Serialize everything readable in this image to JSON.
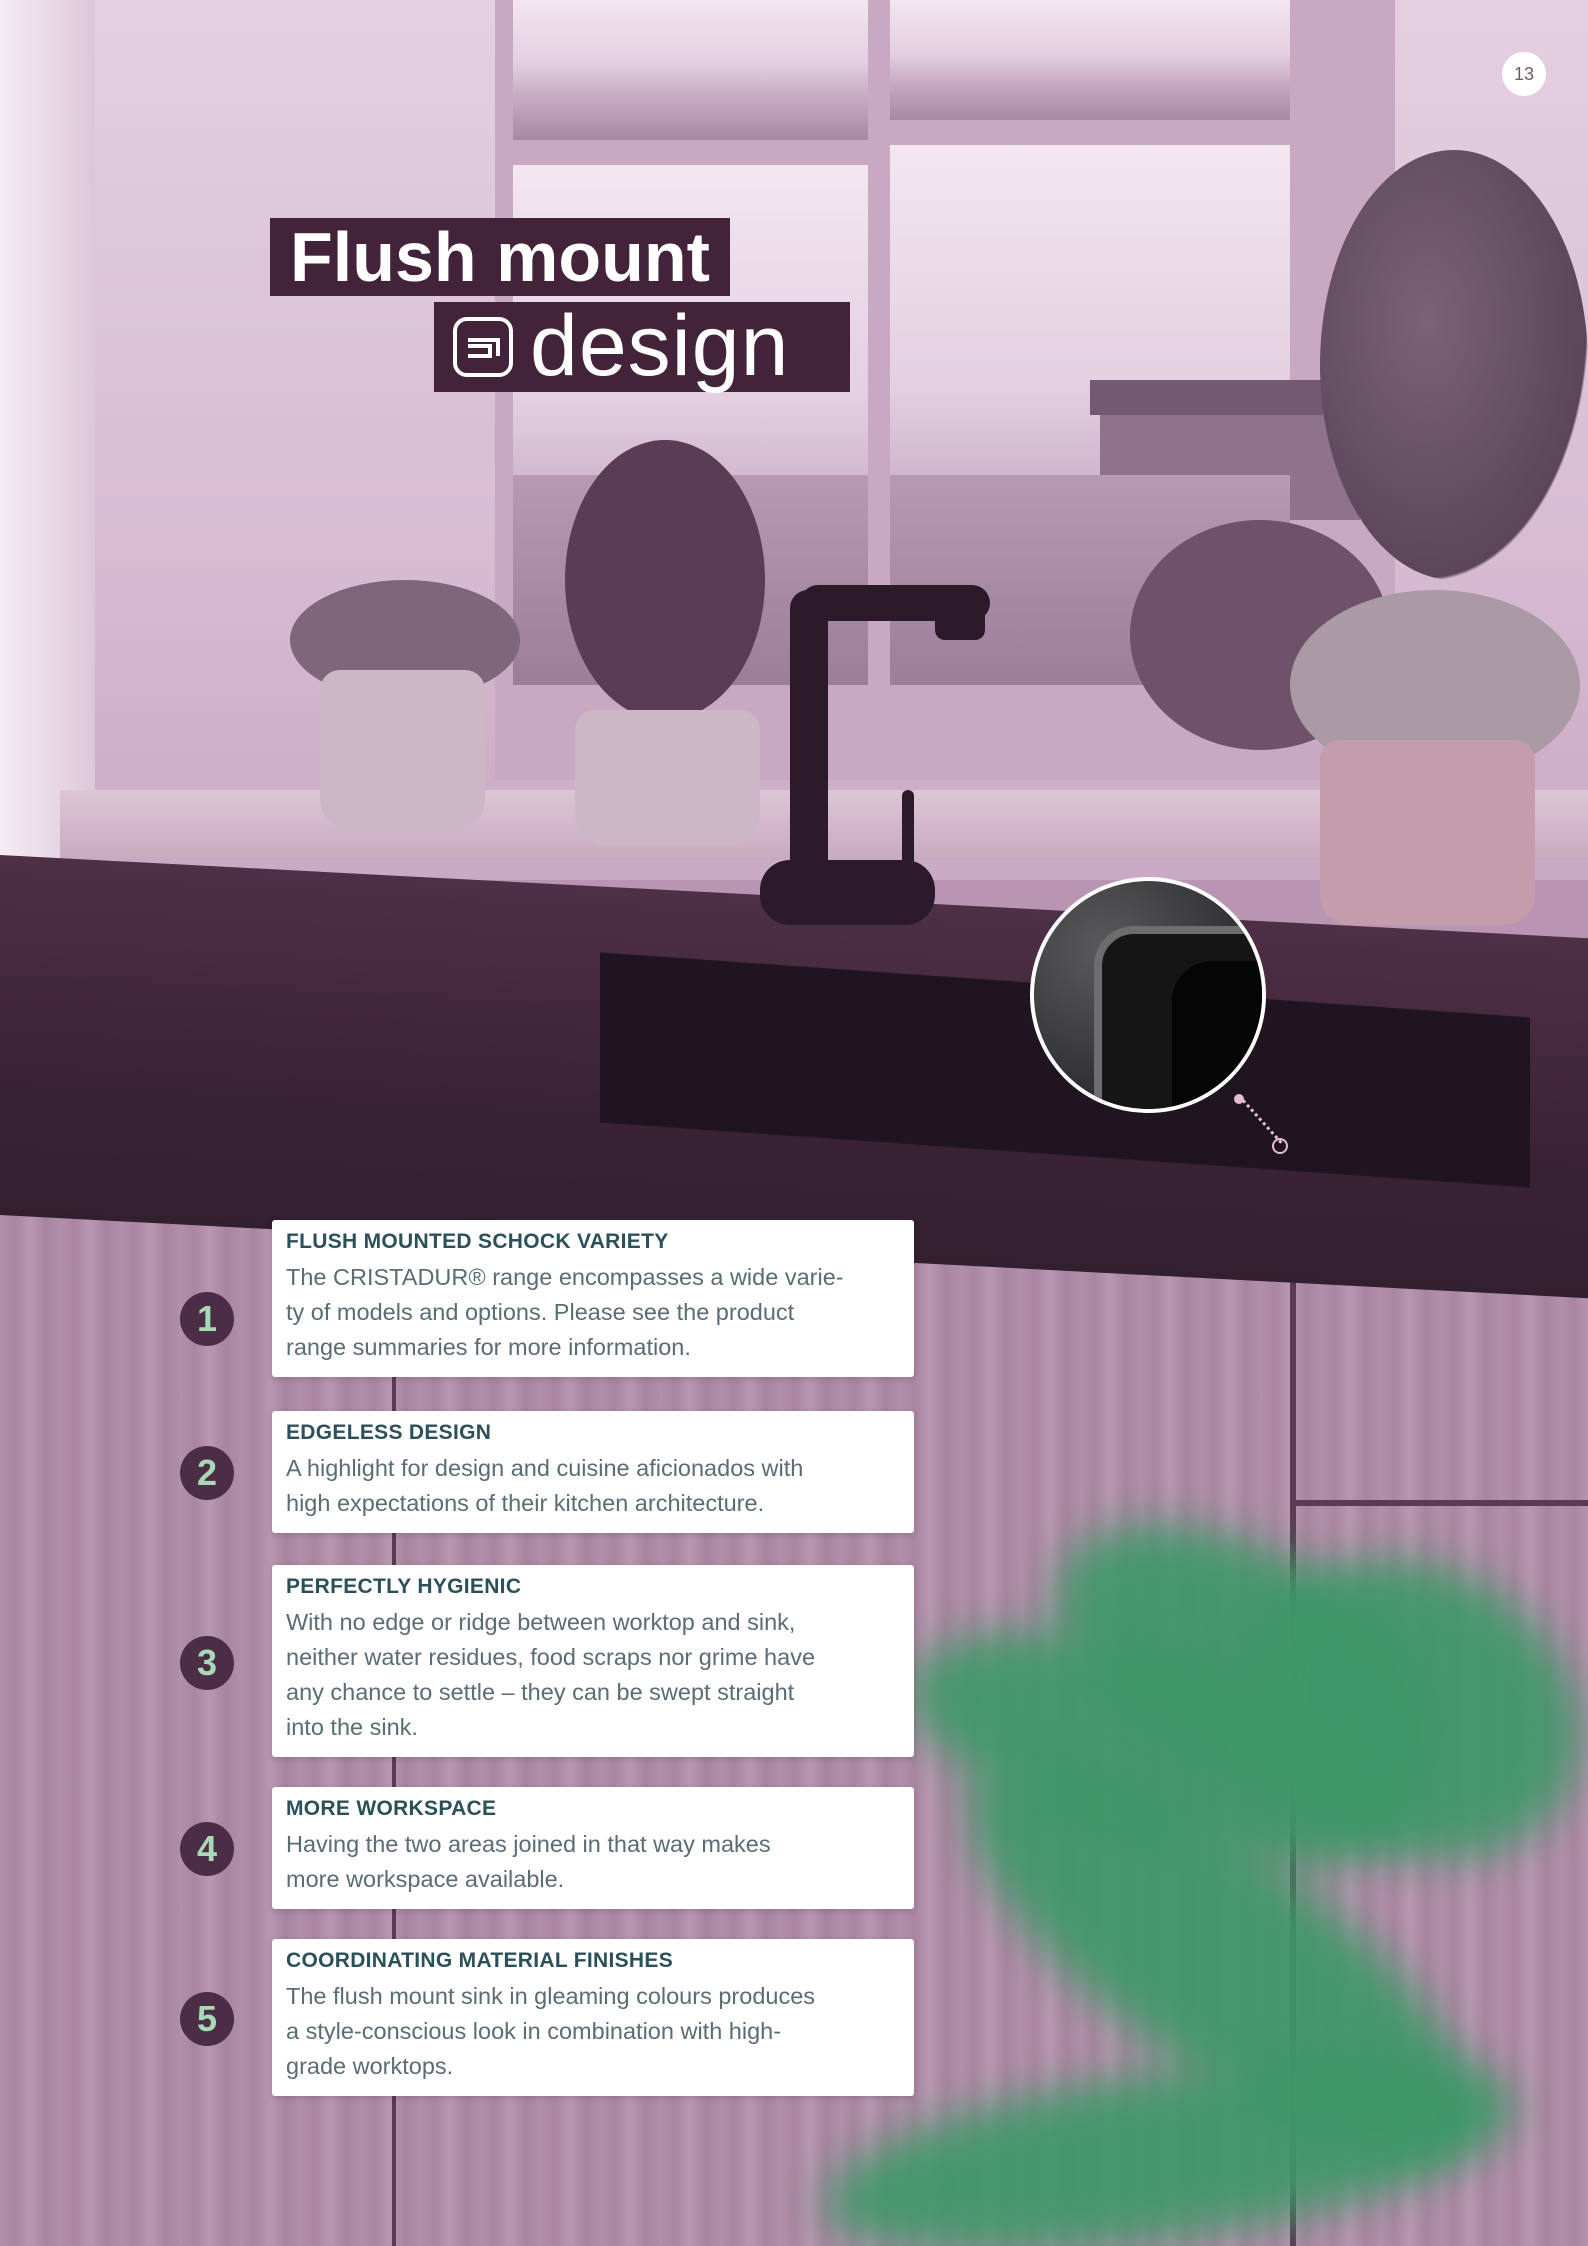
{
  "page_number": "13",
  "title": {
    "line1": "Flush mount",
    "line2": "design"
  },
  "icons": {
    "design": "sink-flush-icon",
    "detail": "zoom-detail-circle"
  },
  "colors": {
    "title_background": "#432339",
    "badge_background": "#4b2d45",
    "badge_number": "#a8d9b7",
    "heading_text": "#2c505a",
    "body_text": "#5a6c74"
  },
  "features": [
    {
      "number": "1",
      "heading": "FLUSH MOUNTED SCHOCK VARIETY",
      "lines": [
        "The CRISTADUR® range encompasses a wide varie-",
        "ty of models and options. Please see the product",
        "range summaries for more information."
      ]
    },
    {
      "number": "2",
      "heading": "EDGELESS DESIGN",
      "lines": [
        "A highlight for design and cuisine aficionados with",
        "high expectations of their kitchen architecture."
      ]
    },
    {
      "number": "3",
      "heading": "PERFECTLY HYGIENIC",
      "lines": [
        "With no edge or ridge between worktop and sink,",
        "neither water residues, food scraps nor grime have",
        "any chance to settle – they can be swept straight",
        "into the sink."
      ]
    },
    {
      "number": "4",
      "heading": "MORE WORKSPACE",
      "lines": [
        "Having the two areas joined in that way makes",
        "more workspace available."
      ]
    },
    {
      "number": "5",
      "heading": "COORDINATING MATERIAL FINISHES",
      "lines": [
        "The flush mount sink in gleaming colours produces",
        "a style-conscious look in combination with high-",
        "grade worktops."
      ]
    }
  ]
}
